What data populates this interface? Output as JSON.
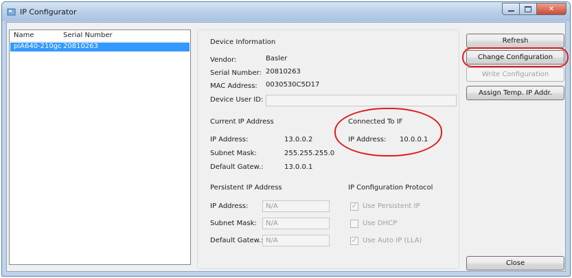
{
  "window": {
    "title": "IP Configurator"
  },
  "device_list": {
    "columns": [
      "Name",
      "Serial Number"
    ],
    "rows": [
      {
        "name": "piA640-210gc",
        "serial": "20810263",
        "selected": true
      }
    ]
  },
  "device_info": {
    "header": "Device Information",
    "vendor_label": "Vendor:",
    "vendor": "Basler",
    "serial_label": "Serial Number:",
    "serial": "20810263",
    "mac_label": "MAC Address:",
    "mac": "0030530C5D17",
    "user_id_label": "Device User ID:",
    "user_id": ""
  },
  "current_ip": {
    "header": "Current IP Address",
    "ip_label": "IP Address:",
    "ip": "13.0.0.2",
    "mask_label": "Subnet Mask:",
    "mask": "255.255.255.0",
    "gw_label": "Default Gatew.:",
    "gw": "13.0.0.1"
  },
  "connected_to_if": {
    "header": "Connected To IF",
    "ip_label": "IP Address:",
    "ip": "10.0.0.1"
  },
  "persistent_ip": {
    "header": "Persistent IP Address",
    "ip_label": "IP Address:",
    "ip": "N/A",
    "mask_label": "Subnet Mask:",
    "mask": "N/A",
    "gw_label": "Default Gatew.:",
    "gw": "N/A"
  },
  "ip_protocol": {
    "header": "IP Configuration Protocol",
    "use_persistent_ip": {
      "label": "Use Persistent IP",
      "checked": true
    },
    "use_dhcp": {
      "label": "Use DHCP",
      "checked": false
    },
    "use_auto_ip": {
      "label": "Use Auto IP (LLA)",
      "checked": true
    }
  },
  "buttons": {
    "refresh": "Refresh",
    "change_configuration": "Change Configuration",
    "write_configuration": "Write Configuration",
    "assign_temp_ip": "Assign Temp. IP Addr.",
    "close": "Close"
  },
  "colors": {
    "selection": "#3399ff",
    "highlight_ring": "#e01a1a",
    "window_frame": "#bfd3ea"
  }
}
